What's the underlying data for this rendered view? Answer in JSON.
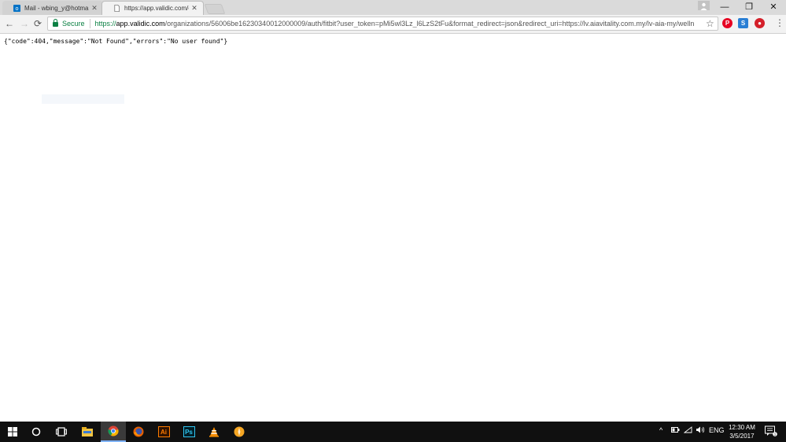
{
  "browser": {
    "tabs": [
      {
        "title": "Mail - wbing_y@hotmail",
        "active": false,
        "icon": "outlook-icon"
      },
      {
        "title": "https://app.validic.com/o",
        "active": true,
        "icon": "page-icon"
      }
    ],
    "window_controls": {
      "minimize": "—",
      "restore": "❐",
      "close": "✕"
    },
    "nav": {
      "back": "←",
      "forward": "→",
      "reload": "⟳"
    },
    "security_label": "Secure",
    "url": {
      "scheme": "https://",
      "host": "app.validic.com",
      "rest": "/organizations/56006be16230340012000009/auth/fitbit?user_token=pMi5wl3Lz_l6LzS2tFu&format_redirect=json&redirect_uri=https://lv.aiavitality.com.my/lv-aia-my/welln"
    },
    "extensions": [
      {
        "name": "pinterest-icon",
        "color": "#e60023",
        "glyph": "P"
      },
      {
        "name": "sync-extension-icon",
        "color": "#2a7fd4",
        "glyph": "S"
      },
      {
        "name": "red-extension-icon",
        "color": "#d4202a",
        "glyph": "●"
      }
    ],
    "bookmark": "☆",
    "menu": "⋮"
  },
  "page": {
    "body_text": "{\"code\":404,\"message\":\"Not Found\",\"errors\":\"No user found\"}"
  },
  "taskbar": {
    "apps": [
      {
        "name": "windows-start-icon"
      },
      {
        "name": "cortana-search-icon"
      },
      {
        "name": "task-view-icon"
      },
      {
        "name": "file-explorer-icon"
      },
      {
        "name": "chrome-icon",
        "active": true
      },
      {
        "name": "firefox-icon"
      },
      {
        "name": "illustrator-icon",
        "label": "Ai"
      },
      {
        "name": "photoshop-icon",
        "label": "Ps"
      },
      {
        "name": "vlc-icon"
      },
      {
        "name": "orange-app-icon"
      }
    ],
    "tray": {
      "language": "ENG",
      "time": "12:30 AM",
      "date": "3/5/2017",
      "notifications": "1"
    }
  }
}
